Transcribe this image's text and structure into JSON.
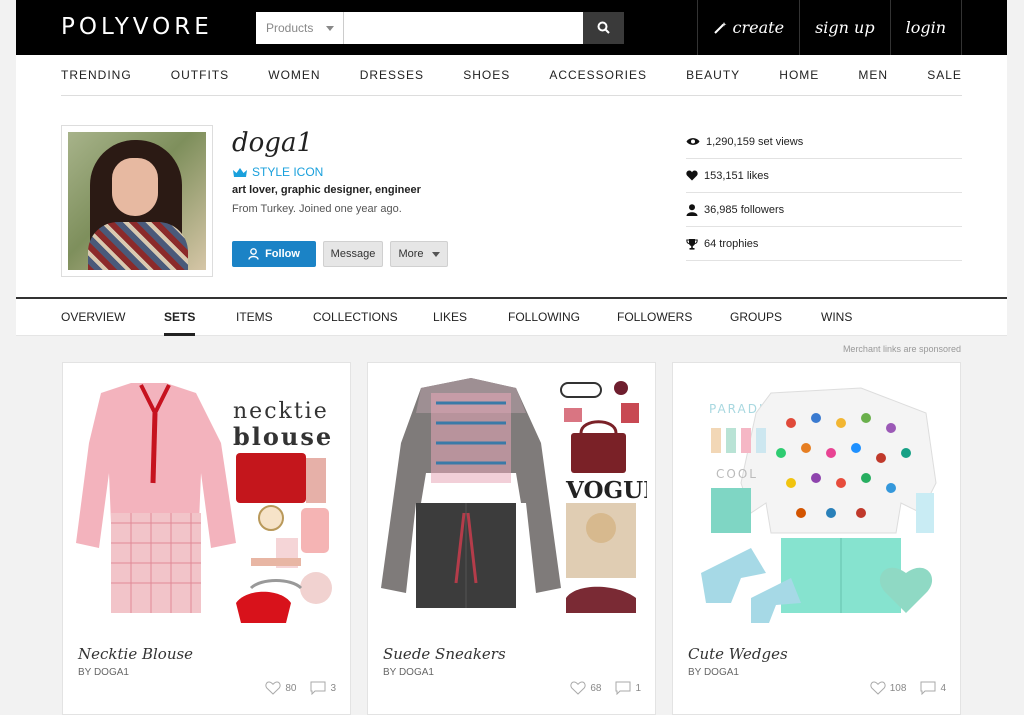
{
  "header": {
    "logo": "POLYVORE",
    "search_category": "Products",
    "search_placeholder": "",
    "links": {
      "create": "create",
      "signup": "sign up",
      "login": "login"
    }
  },
  "nav": [
    "TRENDING",
    "OUTFITS",
    "WOMEN",
    "DRESSES",
    "SHOES",
    "ACCESSORIES",
    "BEAUTY",
    "HOME",
    "MEN",
    "SALE"
  ],
  "profile": {
    "username": "doga1",
    "badge": "STYLE ICON",
    "bio": "art lover, graphic designer, engineer",
    "joined": "From Turkey. Joined one year ago.",
    "buttons": {
      "follow": "Follow",
      "message": "Message",
      "more": "More"
    },
    "stats": {
      "set_views": "1,290,159 set views",
      "likes": "153,151 likes",
      "followers": "36,985 followers",
      "trophies": "64 trophies"
    }
  },
  "tabs": [
    "OVERVIEW",
    "SETS",
    "ITEMS",
    "COLLECTIONS",
    "LIKES",
    "FOLLOWING",
    "FOLLOWERS",
    "GROUPS",
    "WINS"
  ],
  "active_tab": "SETS",
  "sponsored_note": "Merchant links are sponsored",
  "sets": [
    {
      "title": "Necktie Blouse",
      "by": "BY DOGA1",
      "likes": "80",
      "comments": "3",
      "img_text_1": "necktie",
      "img_text_2": "blouse"
    },
    {
      "title": "Suede Sneakers",
      "by": "BY DOGA1",
      "likes": "68",
      "comments": "1",
      "img_text_1": "VOGUE"
    },
    {
      "title": "Cute Wedges",
      "by": "BY DOGA1",
      "likes": "108",
      "comments": "4",
      "img_text_1": "PARADISE",
      "img_text_2": "COOL"
    }
  ],
  "colors": {
    "accent": "#1b83c6",
    "badge": "#1aa0dc",
    "topbar": "#000000"
  }
}
